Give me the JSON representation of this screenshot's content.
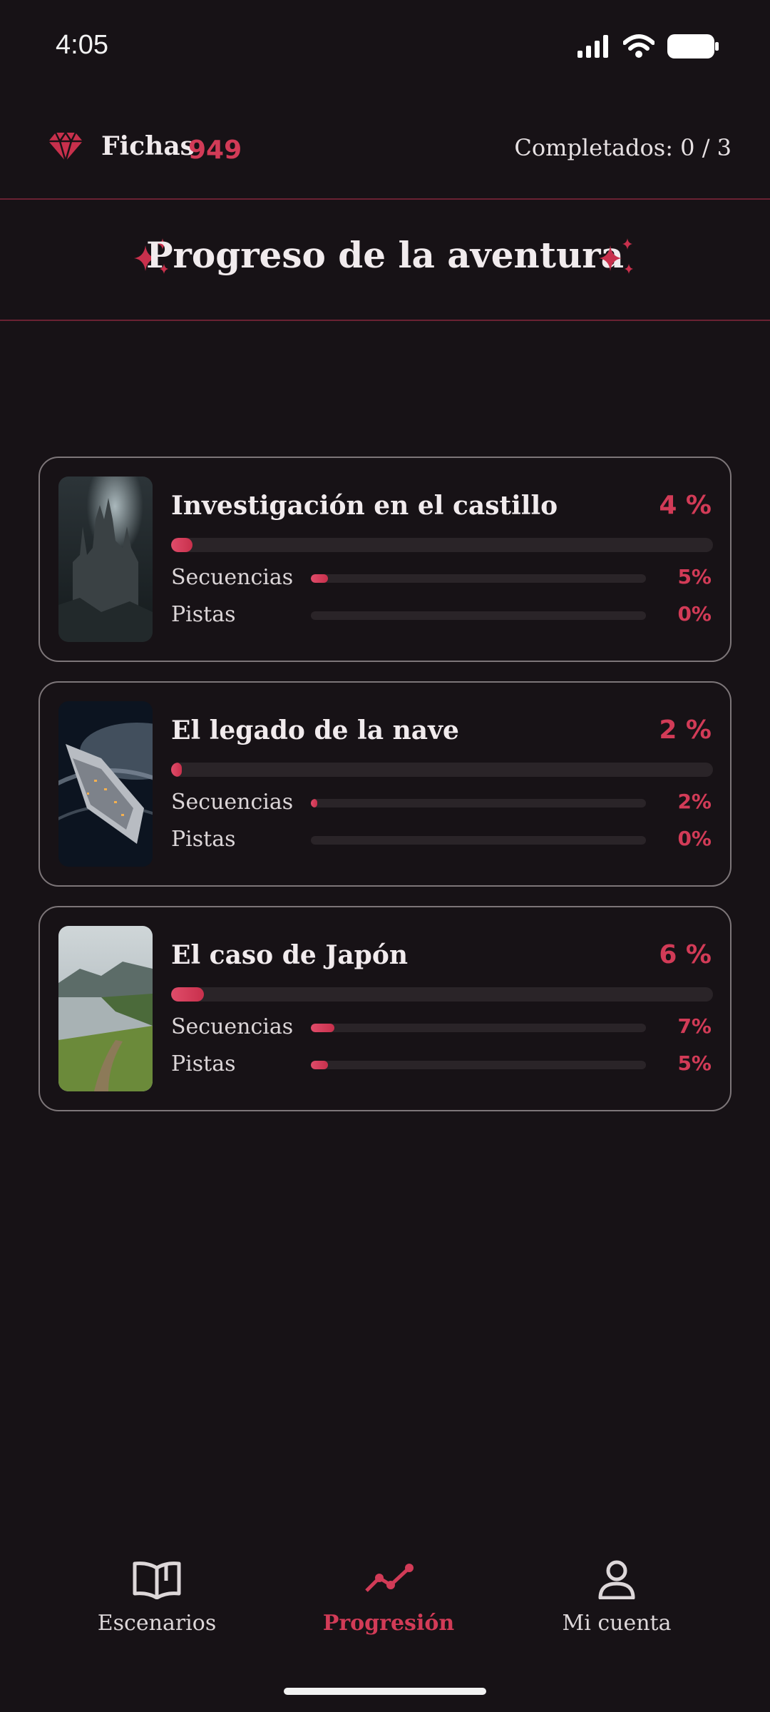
{
  "status_bar": {
    "time": "4:05"
  },
  "header": {
    "tokens_label": "Fichas",
    "tokens_value": "949",
    "completed": "Completados: 0 / 3"
  },
  "page_title": "Progreso de la aventura",
  "labels": {
    "sequences": "Secuencias",
    "clues": "Pistas"
  },
  "scenarios": [
    {
      "title": "Investigación en el castillo",
      "progress": "4 %",
      "progress_value": 4,
      "sequences": "5%",
      "sequences_value": 5,
      "clues": "0%",
      "clues_value": 0
    },
    {
      "title": "El legado de la nave",
      "progress": "2 %",
      "progress_value": 2,
      "sequences": "2%",
      "sequences_value": 2,
      "clues": "0%",
      "clues_value": 0
    },
    {
      "title": "El caso de Japón",
      "progress": "6 %",
      "progress_value": 6,
      "sequences": "7%",
      "sequences_value": 7,
      "clues": "5%",
      "clues_value": 5
    }
  ],
  "nav": {
    "scenarios": "Escenarios",
    "progression": "Progresión",
    "account": "Mi cuenta"
  },
  "colors": {
    "accent": "#d23b57",
    "background": "#171216",
    "border": "#7d7679"
  },
  "icons": {
    "gem": "gem-icon",
    "sparkle": "sparkle-icon",
    "book": "open-book-icon",
    "chart": "trend-line-icon",
    "user": "user-icon"
  }
}
